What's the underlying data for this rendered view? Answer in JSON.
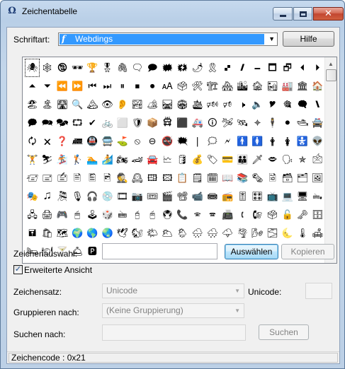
{
  "window": {
    "title": "Zeichentabelle",
    "icon": "charmap-app-icon"
  },
  "font": {
    "label": "Schriftart:",
    "selected": "Webdings",
    "help_button": "Hilfe"
  },
  "grid": {
    "font_name": "Webdings",
    "selected_index": 0,
    "glyphs": [
      "🕷",
      "🕸",
      "🕲",
      "🕶",
      "🏆",
      "🎖",
      "🖇",
      "🗨",
      "🗩",
      "🗰",
      "🗱",
      "🌶",
      "🎗",
      "🙾",
      "🙼",
      "🗕",
      "🗖",
      "🗗",
      "⏴",
      "⏵",
      "⏶",
      "⏷",
      "⏪",
      "⏩",
      "⏮",
      "⏭",
      "⏸",
      "⏹",
      "⏺",
      "🗚",
      "🗳",
      "🛠",
      "🏗",
      "🏘",
      "🏙",
      "🏚",
      "🏜",
      "🏭",
      "🏛",
      "🏠",
      "🏖",
      "🏝",
      "🛣",
      "🔍",
      "🏔",
      "👁",
      "👂",
      "🏞",
      "🏕",
      "🛤",
      "🏟",
      "🛳",
      "🕬",
      "🕫",
      "🕨",
      "🔈",
      "🎔",
      "🎕",
      "🗬",
      "🙽",
      "🗭",
      "🗪",
      "🗫",
      "⮔",
      "✔",
      "🚲",
      "⬜",
      "🛡",
      "📦",
      "🛱",
      "⬛",
      "🚑",
      "🛈",
      "🛩",
      "🛰",
      "🟈",
      "🕴",
      "⚫",
      "🛥",
      "🚔",
      "🗘",
      "🗙",
      "❓",
      "🛲",
      "🚇",
      "🚍",
      "⛳",
      "⦸",
      "⊖",
      "🚭",
      "🗮",
      "|",
      "🗯",
      "🗲",
      "🚹",
      "🚺",
      "🛉",
      "🛊",
      "🚼",
      "👽",
      "🏋",
      "⛷",
      "🏂",
      "🏌",
      "🏊",
      "🏄",
      "🏍",
      "🏎",
      "🚘",
      "🗠",
      "🛢",
      "💰",
      "🏷",
      "💳",
      "👪",
      "🗡",
      "🗢",
      "🗣",
      "✯",
      "🖄",
      "🖅",
      "🖃",
      "🖆",
      "🖹",
      "🖺",
      "🖻",
      "🕵",
      "🕰",
      "🖽",
      "🖾",
      "📋",
      "🗒",
      "🗓",
      "📖",
      "📚",
      "🗞",
      "🗟",
      "🗃",
      "🗂",
      "🖼",
      "🎭",
      "🎜",
      "🎘",
      "🎙",
      "🎧",
      "💿",
      "🎞",
      "📷",
      "🎟",
      "🎬",
      "📽",
      "📹",
      "📾",
      "📻",
      "🎚",
      "🎛",
      "📺",
      "💻",
      "🖥",
      "🖦",
      "🖧",
      "🖨",
      "🎮",
      "🖱",
      "🕹",
      "🎲",
      "🖮",
      "🖯",
      "🖰",
      "🖲",
      "📞",
      "🕾",
      "🕿",
      "📠",
      "🕻",
      "🕼",
      "🗳",
      "🔓",
      "🗝",
      "🗄",
      "🖬",
      "🛍",
      "🗺",
      "🌍",
      "🌎",
      "🌏",
      "🕊",
      "🐿",
      "🌤",
      "🌥",
      "🌦",
      "🌧",
      "🌨",
      "🌩",
      "🌪",
      "🌬",
      "🌫",
      "🌜",
      "🌡",
      "🛋",
      "🛏",
      "🍽",
      "🍸",
      "🛎",
      "🅿"
    ]
  },
  "char_select": {
    "label": "Zeichenauswahl:",
    "value": "",
    "select_button": "Auswählen",
    "copy_button": "Kopieren"
  },
  "advanced": {
    "label": "Erweiterte Ansicht",
    "checked": true
  },
  "charset": {
    "label": "Zeichensatz:",
    "value": "Unicode",
    "unicode_label": "Unicode:",
    "unicode_value": ""
  },
  "group_by": {
    "label": "Gruppieren nach:",
    "value": "(Keine Gruppierung)"
  },
  "search": {
    "label": "Suchen nach:",
    "value": "",
    "button": "Suchen"
  },
  "status": {
    "text": "Zeichencode : 0x21"
  }
}
